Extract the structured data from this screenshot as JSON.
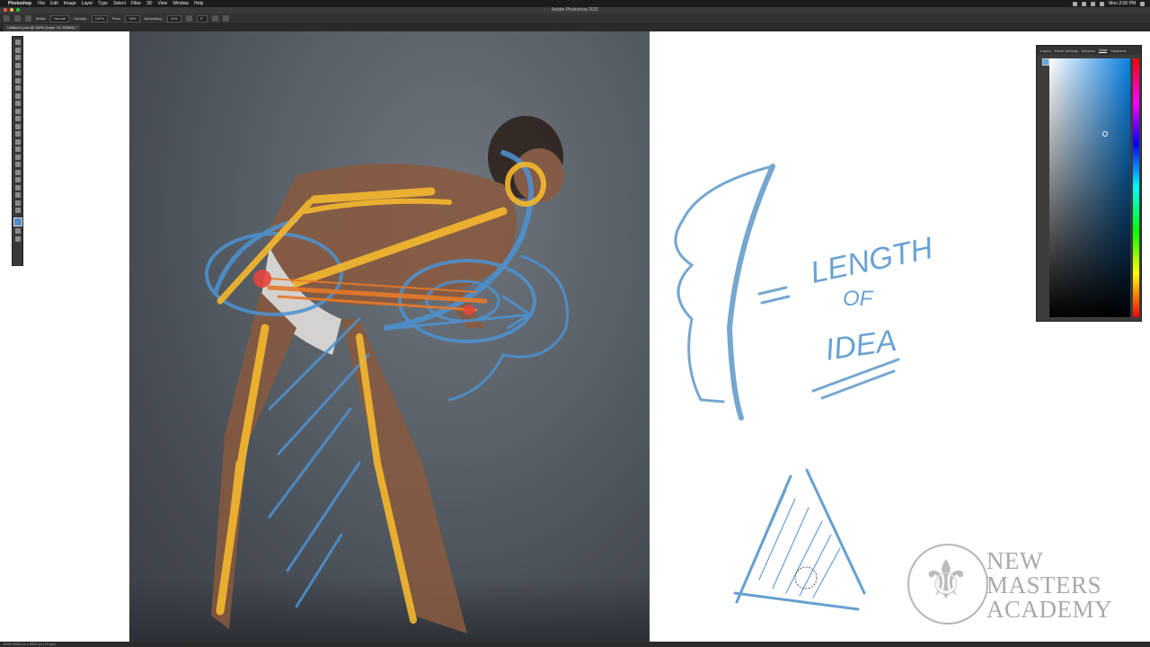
{
  "menubar": {
    "app_name": "Photoshop",
    "menus": [
      "File",
      "Edit",
      "Image",
      "Layer",
      "Type",
      "Select",
      "Filter",
      "3D",
      "View",
      "Window",
      "Help"
    ],
    "clock": "Mon 2:06 PM"
  },
  "window": {
    "title": "Adobe Photoshop 2020"
  },
  "options_bar": {
    "mode_label": "Mode:",
    "mode_value": "Normal",
    "opacity_label": "Opacity:",
    "opacity_value": "100%",
    "flow_label": "Flow:",
    "flow_value": "29%",
    "smoothing_label": "Smoothing:",
    "smoothing_value": "10%",
    "angle_value": "0°"
  },
  "document": {
    "tab_label": "Untitled-1.psd @ 100% (Layer 19, RGB/8) *"
  },
  "color_panel": {
    "tabs": [
      "Layers",
      "Brush Settings",
      "Brushes",
      "Color",
      "Swatches"
    ],
    "active_tab": "Color",
    "foreground_color": "#5aa8e6"
  },
  "canvas_notes": {
    "line1": "LENGTH",
    "line2": "OF",
    "line3": "IDEA",
    "equals": "="
  },
  "watermark": {
    "line1": "NEW",
    "line2": "MASTERS",
    "line3": "ACADEMY"
  },
  "statusbar": {
    "text": "100%   8000 px x 5000 px (72 ppi)"
  },
  "colors": {
    "sketch_blue": "#4c93d3",
    "sketch_yellow": "#f5b82e",
    "sketch_red": "#e8453c",
    "sketch_orange": "#e67a2a"
  }
}
